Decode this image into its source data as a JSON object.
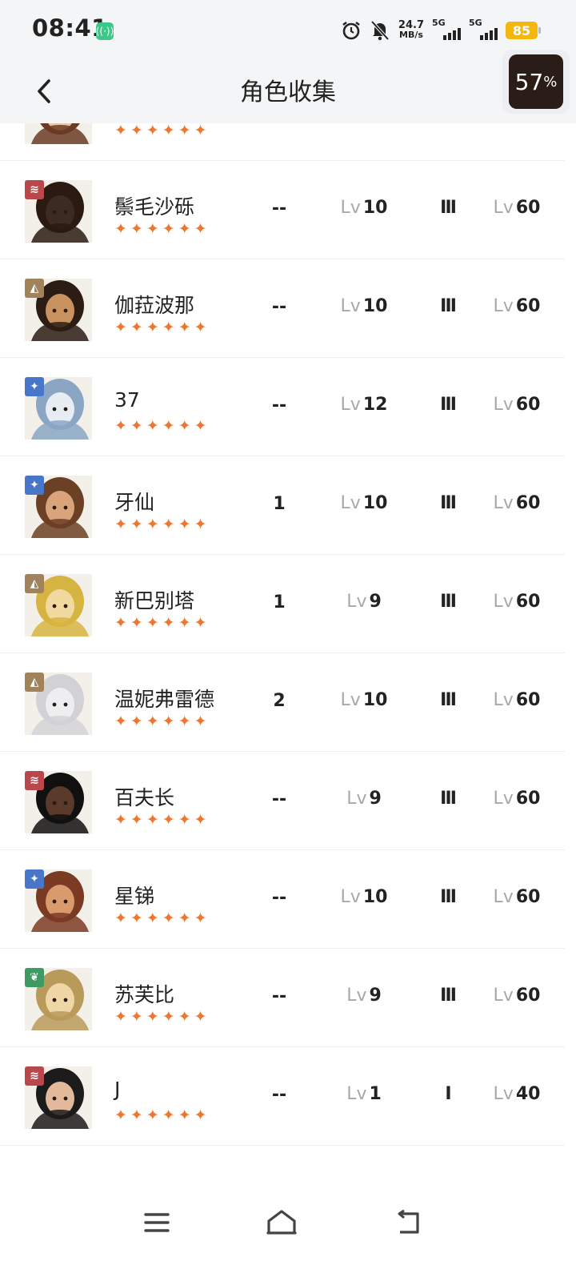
{
  "status_bar": {
    "time": "08:41",
    "net_speed_value": "24.7",
    "net_speed_unit": "MB/s",
    "sim1_label": "5G",
    "sim2_label": "5G",
    "battery": "85",
    "battery_color": "#f3b70d"
  },
  "header": {
    "title": "角色收集",
    "float_value": "57",
    "float_unit": "%"
  },
  "element_colors": {
    "beast": "#b9474b",
    "mineral": "#a0835a",
    "star": "#4876c8",
    "plant": "#3f9a61"
  },
  "characters": [
    {
      "name": "",
      "element": "beast",
      "stars": 6,
      "a": "",
      "lv": "",
      "rank": "",
      "max_lv": ""
    },
    {
      "name": "鬃毛沙砾",
      "element": "beast",
      "stars": 6,
      "a": "--",
      "lv_prefix": "Lv",
      "lv": "10",
      "rank": "Ⅲ",
      "max_prefix": "Lv",
      "max_lv": "60"
    },
    {
      "name": "伽菈波那",
      "element": "mineral",
      "stars": 6,
      "a": "--",
      "lv_prefix": "Lv",
      "lv": "10",
      "rank": "Ⅲ",
      "max_prefix": "Lv",
      "max_lv": "60"
    },
    {
      "name": "37",
      "element": "star",
      "stars": 6,
      "a": "--",
      "lv_prefix": "Lv",
      "lv": "12",
      "rank": "Ⅲ",
      "max_prefix": "Lv",
      "max_lv": "60"
    },
    {
      "name": "牙仙",
      "element": "star",
      "stars": 6,
      "a": "1",
      "lv_prefix": "Lv",
      "lv": "10",
      "rank": "Ⅲ",
      "max_prefix": "Lv",
      "max_lv": "60"
    },
    {
      "name": "新巴别塔",
      "element": "mineral",
      "stars": 6,
      "a": "1",
      "lv_prefix": "Lv",
      "lv": "9",
      "rank": "Ⅲ",
      "max_prefix": "Lv",
      "max_lv": "60"
    },
    {
      "name": "温妮弗雷德",
      "element": "mineral",
      "stars": 6,
      "a": "2",
      "lv_prefix": "Lv",
      "lv": "10",
      "rank": "Ⅲ",
      "max_prefix": "Lv",
      "max_lv": "60"
    },
    {
      "name": "百夫长",
      "element": "beast",
      "stars": 6,
      "a": "--",
      "lv_prefix": "Lv",
      "lv": "9",
      "rank": "Ⅲ",
      "max_prefix": "Lv",
      "max_lv": "60"
    },
    {
      "name": "星锑",
      "element": "star",
      "stars": 6,
      "a": "--",
      "lv_prefix": "Lv",
      "lv": "10",
      "rank": "Ⅲ",
      "max_prefix": "Lv",
      "max_lv": "60"
    },
    {
      "name": "苏芙比",
      "element": "plant",
      "stars": 6,
      "a": "--",
      "lv_prefix": "Lv",
      "lv": "9",
      "rank": "Ⅲ",
      "max_prefix": "Lv",
      "max_lv": "60"
    },
    {
      "name": "J",
      "element": "beast",
      "stars": 6,
      "a": "--",
      "lv_prefix": "Lv",
      "lv": "1",
      "rank": "Ⅰ",
      "max_prefix": "Lv",
      "max_lv": "40"
    }
  ],
  "nav": {
    "menu_icon": "menu-icon",
    "home_icon": "home-icon",
    "back_icon": "back-icon"
  }
}
